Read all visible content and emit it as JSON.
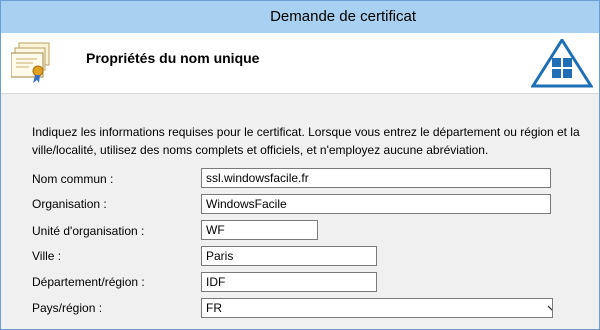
{
  "window": {
    "title": "Demande de certificat"
  },
  "header": {
    "heading": "Propriétés du nom unique"
  },
  "instructions": "Indiquez les informations requises pour le certificat. Lorsque vous entrez le département ou région et la ville/localité, utilisez des noms complets et officiels, et n'employez aucune abréviation.",
  "form": {
    "common_name": {
      "label": "Nom commun :",
      "value": "ssl.windowsfacile.fr"
    },
    "organization": {
      "label": "Organisation :",
      "value": "WindowsFacile"
    },
    "org_unit": {
      "label": "Unité d'organisation :",
      "value": "WF"
    },
    "city": {
      "label": "Ville :",
      "value": "Paris"
    },
    "state": {
      "label": "Département/région :",
      "value": "IDF"
    },
    "country": {
      "label": "Pays/région :",
      "value": "FR"
    }
  },
  "colors": {
    "titlebar": "#a8d0f0",
    "logo_blue": "#1e6fb5"
  },
  "icons": {
    "header": "certificate-icon",
    "brand": "windowsfacile-logo"
  }
}
